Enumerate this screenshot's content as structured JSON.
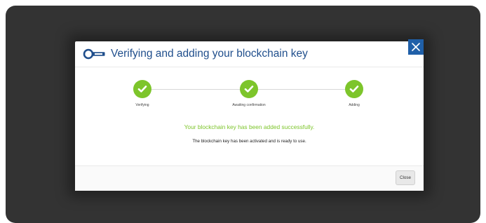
{
  "dialog": {
    "title": "Verifying and adding your blockchain key",
    "close_icon": "close-x-icon",
    "key_icon": "key-icon"
  },
  "steps": [
    {
      "label": "Verifying",
      "status": "complete",
      "icon": "check-icon"
    },
    {
      "label": "Awaiting confirmation",
      "status": "complete",
      "icon": "check-icon"
    },
    {
      "label": "Adding",
      "status": "complete",
      "icon": "check-icon"
    }
  ],
  "message": {
    "title": "Your blockchain key has been added successfully.",
    "description": "The blockchain key has been activated and is ready to use."
  },
  "footer": {
    "close_label": "Close"
  },
  "colors": {
    "backdrop": "#333333",
    "title_blue": "#1f4e8c",
    "close_x_bg": "#1f5fa8",
    "success_green": "#7dc52b"
  }
}
